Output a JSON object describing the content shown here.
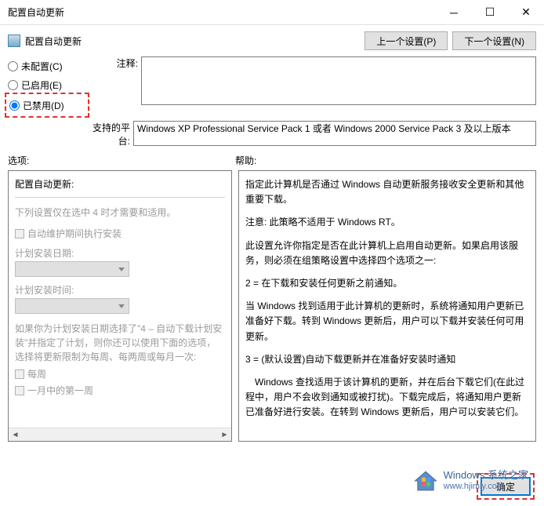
{
  "window": {
    "title": "配置自动更新"
  },
  "header": {
    "title": "配置自动更新",
    "prev_btn": "上一个设置(P)",
    "next_btn": "下一个设置(N)"
  },
  "radios": {
    "not_configured": "未配置(C)",
    "enabled": "已启用(E)",
    "disabled": "已禁用(D)"
  },
  "labels": {
    "comment": "注释:",
    "platform": "支持的平台:",
    "options": "选项:",
    "help": "帮助:"
  },
  "platform_text": "Windows XP Professional Service Pack 1 或者 Windows 2000 Service Pack 3 及以上版本",
  "options": {
    "heading": "配置自动更新:",
    "note": "下列设置仅在选中 4 时才需要和适用。",
    "check_auto": "自动维护期间执行安装",
    "sched_day": "计划安装日期:",
    "sched_time": "计划安装时间:",
    "option4_intro": "如果你为计划安装日期选择了\"4 – 自动下载计划安装\"并指定了计划，则你还可以使用下面的选项，选择将更新限制为每周、每两周或每月一次:",
    "weekly": "每周",
    "first_week": "一月中的第一周"
  },
  "help": {
    "p1": "指定此计算机是否通过 Windows 自动更新服务接收安全更新和其他重要下载。",
    "p2": "注意: 此策略不适用于 Windows RT。",
    "p3": "此设置允许你指定是否在此计算机上启用自动更新。如果启用该服务，则必须在组策略设置中选择四个选项之一:",
    "p4": "2 = 在下载和安装任何更新之前通知。",
    "p5": "当 Windows 找到适用于此计算机的更新时，系统将通知用户更新已准备好下载。转到 Windows 更新后，用户可以下载并安装任何可用更新。",
    "p6": "3 = (默认设置)自动下载更新并在准备好安装时通知",
    "p7": "Windows 查找适用于该计算机的更新，并在后台下载它们(在此过程中，用户不会收到通知或被打扰)。下载完成后，将通知用户更新已准备好进行安装。在转到 Windows 更新后，用户可以安装它们。"
  },
  "footer": {
    "ok": "确定"
  },
  "watermark": {
    "line1": "Windows 系统之家",
    "line2": "www.hjimly.com"
  }
}
